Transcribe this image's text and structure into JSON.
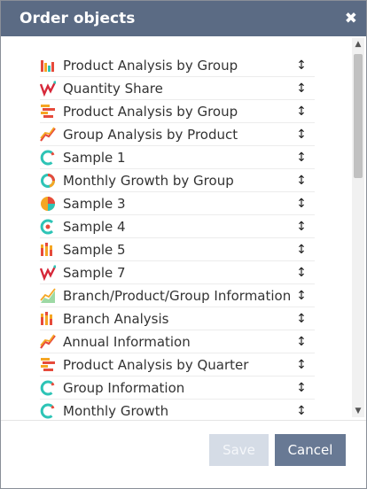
{
  "dialog": {
    "title": "Order objects",
    "close_glyph": "✖"
  },
  "items": [
    {
      "label": "Product Analysis by Group",
      "icon": "bar-chart-icon"
    },
    {
      "label": "Quantity Share",
      "icon": "waterfall-icon"
    },
    {
      "label": "Product Analysis by Group",
      "icon": "horizontal-bar-icon"
    },
    {
      "label": "Group Analysis by Product",
      "icon": "line-chart-icon"
    },
    {
      "label": "Sample 1",
      "icon": "donut-icon"
    },
    {
      "label": "Monthly Growth by Group",
      "icon": "ring-icon"
    },
    {
      "label": "Sample 3",
      "icon": "pie-chart-icon"
    },
    {
      "label": "Sample 4",
      "icon": "gauge-icon"
    },
    {
      "label": "Sample 5",
      "icon": "stacked-bar-icon"
    },
    {
      "label": "Sample 7",
      "icon": "waterfall-icon"
    },
    {
      "label": "Branch/Product/Group Information",
      "icon": "area-chart-icon"
    },
    {
      "label": "Branch Analysis",
      "icon": "stacked-bar-icon"
    },
    {
      "label": "Annual Information",
      "icon": "line-chart-icon"
    },
    {
      "label": "Product Analysis by Quarter",
      "icon": "horizontal-bar-icon"
    },
    {
      "label": "Group Information",
      "icon": "donut-icon"
    },
    {
      "label": "Monthly Growth",
      "icon": "donut-icon"
    }
  ],
  "handle_glyph": "↕",
  "buttons": {
    "save": "Save",
    "cancel": "Cancel"
  },
  "colors": {
    "titlebar": "#5b6b84",
    "cancel": "#687994",
    "save_disabled": "#d5dce6"
  }
}
